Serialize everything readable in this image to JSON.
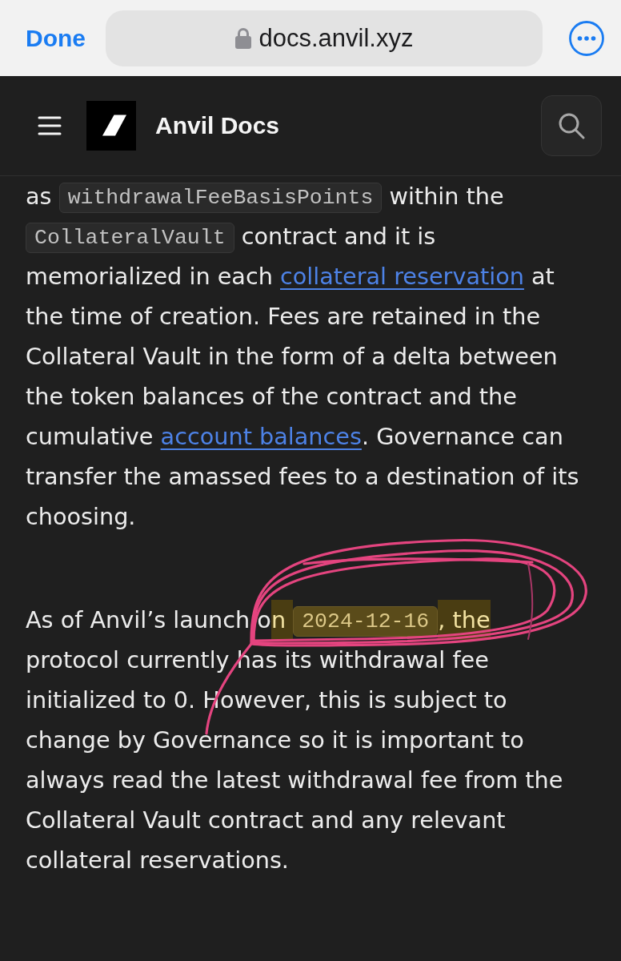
{
  "browser_bar": {
    "done_label": "Done",
    "url": "docs.anvil.xyz",
    "secure": true
  },
  "header": {
    "title": "Anvil Docs"
  },
  "content": {
    "paragraphs": [
      {
        "segments": [
          {
            "kind": "text",
            "text": "as ",
            "highlighted": false
          },
          {
            "kind": "code",
            "text": "withdrawalFeeBasisPoints",
            "highlighted": false
          },
          {
            "kind": "text",
            "text": " within the ",
            "highlighted": false
          },
          {
            "kind": "code",
            "text": "CollateralVault",
            "highlighted": false
          },
          {
            "kind": "text",
            "text": " contract and it is memorialized in each ",
            "highlighted": false
          },
          {
            "kind": "link",
            "text": "collateral reservation",
            "highlighted": false
          },
          {
            "kind": "text",
            "text": " at the time of creation. Fees are retained in the Collateral Vault in the form of a delta between the token balances of the contract and the cumulative ",
            "highlighted": false
          },
          {
            "kind": "link",
            "text": "account balances",
            "highlighted": false
          },
          {
            "kind": "text",
            "text": ". Governance can transfer the amassed fees to a destination of its choosing.",
            "highlighted": false
          }
        ]
      },
      {
        "segments": [
          {
            "kind": "text",
            "text": "As of Anvil’s launch o",
            "highlighted": false
          },
          {
            "kind": "text",
            "text": "n ",
            "highlighted": true
          },
          {
            "kind": "code",
            "text": "2024-12-16",
            "highlighted": true
          },
          {
            "kind": "text",
            "text": ", the",
            "highlighted": true
          },
          {
            "kind": "text",
            "text": " protocol currently has its withdrawal fee initialized to 0. However, this is subject to change by Governance so it is important to always read the latest withdrawal fee from the Collateral Vault contract and any relevant collateral reservations.",
            "highlighted": false
          }
        ]
      }
    ]
  }
}
